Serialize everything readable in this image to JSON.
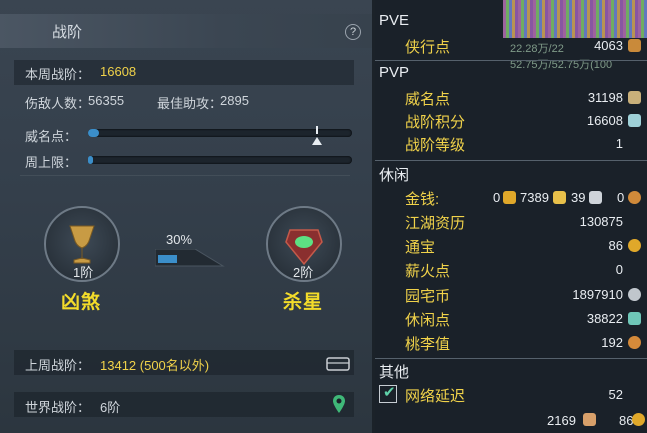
{
  "left_panel": {
    "title": "战阶",
    "help": "?",
    "weekly_rank_label": "本周战阶：",
    "weekly_rank_value": "16608",
    "defeated_label": "伤敌人数：",
    "defeated_value": "56355",
    "assist_label": "最佳助攻：",
    "assist_value": "2895",
    "prestige_label": "威名点：",
    "prestige_progress": 0.04,
    "weekly_cap_label": "周上限：",
    "weekly_cap_progress": 0.02,
    "rank_left": {
      "level": "1阶",
      "name": "凶煞"
    },
    "rank_right": {
      "level": "2阶",
      "name": "杀星"
    },
    "progress_percent": "30%",
    "progress_value": 0.3,
    "last_week_label": "上周战阶：",
    "last_week_value": "13412 (500名以外)",
    "world_rank_label": "世界战阶：",
    "world_rank_value": "6阶"
  },
  "right_panel": {
    "pve_title": "PVE",
    "pve_items": [
      {
        "label": "侠行点",
        "value": "4063"
      }
    ],
    "pvp_title": "PVP",
    "pvp_items": [
      {
        "label": "威名点",
        "value": "31198"
      },
      {
        "label": "战阶积分",
        "value": "16608"
      },
      {
        "label": "战阶等级",
        "value": "1"
      }
    ],
    "leisure_title": "休闲",
    "money_label": "金钱:",
    "money_values": [
      "0",
      "7389",
      "39",
      "0"
    ],
    "leisure_items": [
      {
        "label": "江湖资历",
        "value": "130875"
      },
      {
        "label": "通宝",
        "value": "86"
      },
      {
        "label": "薪火点",
        "value": "0"
      },
      {
        "label": "园宅币",
        "value": "1897910"
      },
      {
        "label": "休闲点",
        "value": "38822"
      },
      {
        "label": "桃李值",
        "value": "192"
      }
    ],
    "other_title": "其他",
    "network_label": "网络延迟",
    "network_value": "52",
    "footer_value_1": "2169",
    "footer_value_2": "86",
    "bg_texts": [
      "22.28万/22",
      "52.75万/52.75万(100"
    ]
  },
  "colors": {
    "accent_yellow": "#f0d24a",
    "bar_blue": "#3b8ec9"
  }
}
